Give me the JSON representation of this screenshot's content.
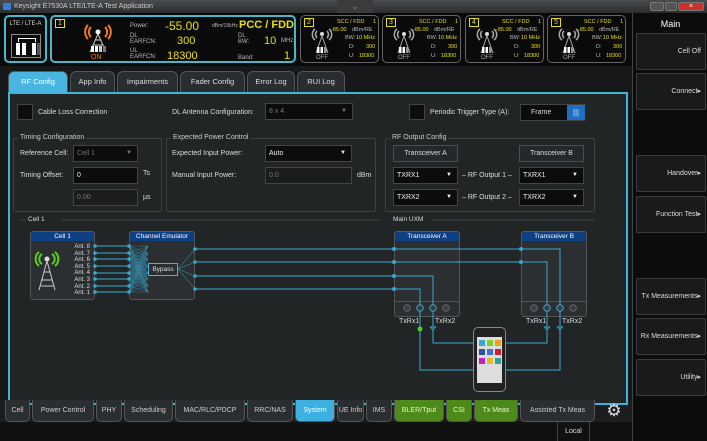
{
  "window": {
    "title": "Keysight E7530A LTE/LTE-A Test Application"
  },
  "status": {
    "mode": "LTE / LTE-A",
    "pcc": {
      "index": "1",
      "state": "ON",
      "power_label": "Power:",
      "power": "-55.00",
      "power_unit": "dBm/15kHz",
      "type": "PCC / FDD",
      "dl_earfcn_label": "DL EARFCN:",
      "dl_earfcn": "300",
      "dl_bw_label": "DL BW:",
      "dl_bw": "10",
      "dl_bw_unit": "MHz",
      "ul_earfcn_label": "UL EARFCN:",
      "ul_earfcn": "18300",
      "band_label": "Band:",
      "band": "1"
    },
    "sccs": [
      {
        "index": "2",
        "type": "SCC / FDD",
        "band": "1",
        "power": "-85.00",
        "power_unit": "dBm/RE",
        "bw_label": "BW:",
        "bw": "10 MHz",
        "d_label": "D:",
        "d": "300",
        "u_label": "U:",
        "u": "18300",
        "state": "OFF"
      },
      {
        "index": "3",
        "type": "SCC / FDD",
        "band": "1",
        "power": "-85.00",
        "power_unit": "dBm/RE",
        "bw_label": "BW:",
        "bw": "10 MHz",
        "d_label": "D:",
        "d": "300",
        "u_label": "U:",
        "u": "18300",
        "state": "OFF"
      },
      {
        "index": "4",
        "type": "SCC / FDD",
        "band": "1",
        "power": "-85.00",
        "power_unit": "dBm/RE",
        "bw_label": "BW:",
        "bw": "10 MHz",
        "d_label": "D:",
        "d": "300",
        "u_label": "U:",
        "u": "18300",
        "state": "OFF"
      },
      {
        "index": "5",
        "type": "SCC / FDD",
        "band": "1",
        "power": "-85.00",
        "power_unit": "dBm/RE",
        "bw_label": "BW:",
        "bw": "10 MHz",
        "d_label": "D:",
        "d": "300",
        "u_label": "U:",
        "u": "18300",
        "state": "OFF"
      }
    ],
    "on_color": "#f07a1a",
    "active_color": "#e8e000"
  },
  "tabs": [
    "RF Config",
    "App Info",
    "Impairments",
    "Fader Config",
    "Error Log",
    "RUI Log"
  ],
  "rf": {
    "cable_loss": "Cable Loss Correction",
    "dl_ant_label": "DL Antenna Configuration:",
    "dl_ant": "8 x 4",
    "trigger_label": "Periodic Trigger Type (A):",
    "trigger": "Frame",
    "timing": {
      "title": "Timing Configuration",
      "ref_label": "Reference Cell:",
      "ref": "Cell 1",
      "offset_label": "Timing Offset:",
      "offset": "0",
      "offset_unit": "Ts",
      "us": "0.00",
      "us_unit": "µs"
    },
    "power": {
      "title": "Expected Power Control",
      "exp_label": "Expected Input Power:",
      "exp": "Auto",
      "man_label": "Manual Input Power:",
      "man": "0.0",
      "man_unit": "dBm"
    },
    "rfout": {
      "title": "RF Output Config",
      "ta": "Transceiver A",
      "tb": "Transceiver B",
      "o1": "– RF Output 1 –",
      "o2": "– RF Output 2 –",
      "a1": "TXRX1",
      "a2": "TXRX2",
      "b1": "TXRX1",
      "b2": "TXRX2"
    }
  },
  "diagram": {
    "cell_group": "Cell 1",
    "uxm_group": "Main UXM",
    "cell_box": "Cell 1",
    "emulator": "Channel Emulator",
    "bypass": "Bypass",
    "antennas": [
      "Ant. 8",
      "Ant. 7",
      "Ant. 6",
      "Ant. 5",
      "Ant. 4",
      "Ant. 3",
      "Ant. 2",
      "Ant. 1"
    ],
    "trx_a": "Transceiver A",
    "trx_b": "Transceiver B",
    "txrx1": "TxRx1",
    "txrx2": "TxRx2"
  },
  "bottom_tabs": [
    {
      "label": "Cell"
    },
    {
      "label": "Power Control"
    },
    {
      "label": "PHY"
    },
    {
      "label": "Scheduling"
    },
    {
      "label": "MAC/RLC/PDCP"
    },
    {
      "label": "RRC/NAS"
    },
    {
      "label": "System",
      "state": "selected"
    },
    {
      "label": "UE Info"
    },
    {
      "label": "IMS"
    },
    {
      "label": "BLER/Tput",
      "state": "green"
    },
    {
      "label": "CSI",
      "state": "green"
    },
    {
      "label": "Tx Meas",
      "state": "green"
    },
    {
      "label": "Assisted Tx Meas"
    }
  ],
  "statusbar": {
    "mode": "Local"
  },
  "softkeys": {
    "title": "Main",
    "items": [
      "Cell Off",
      "Connect▸",
      "Handover▸",
      "Function Test▸",
      "Tx Measurements▸",
      "Rx Measurements▸",
      "Utility▸"
    ]
  }
}
